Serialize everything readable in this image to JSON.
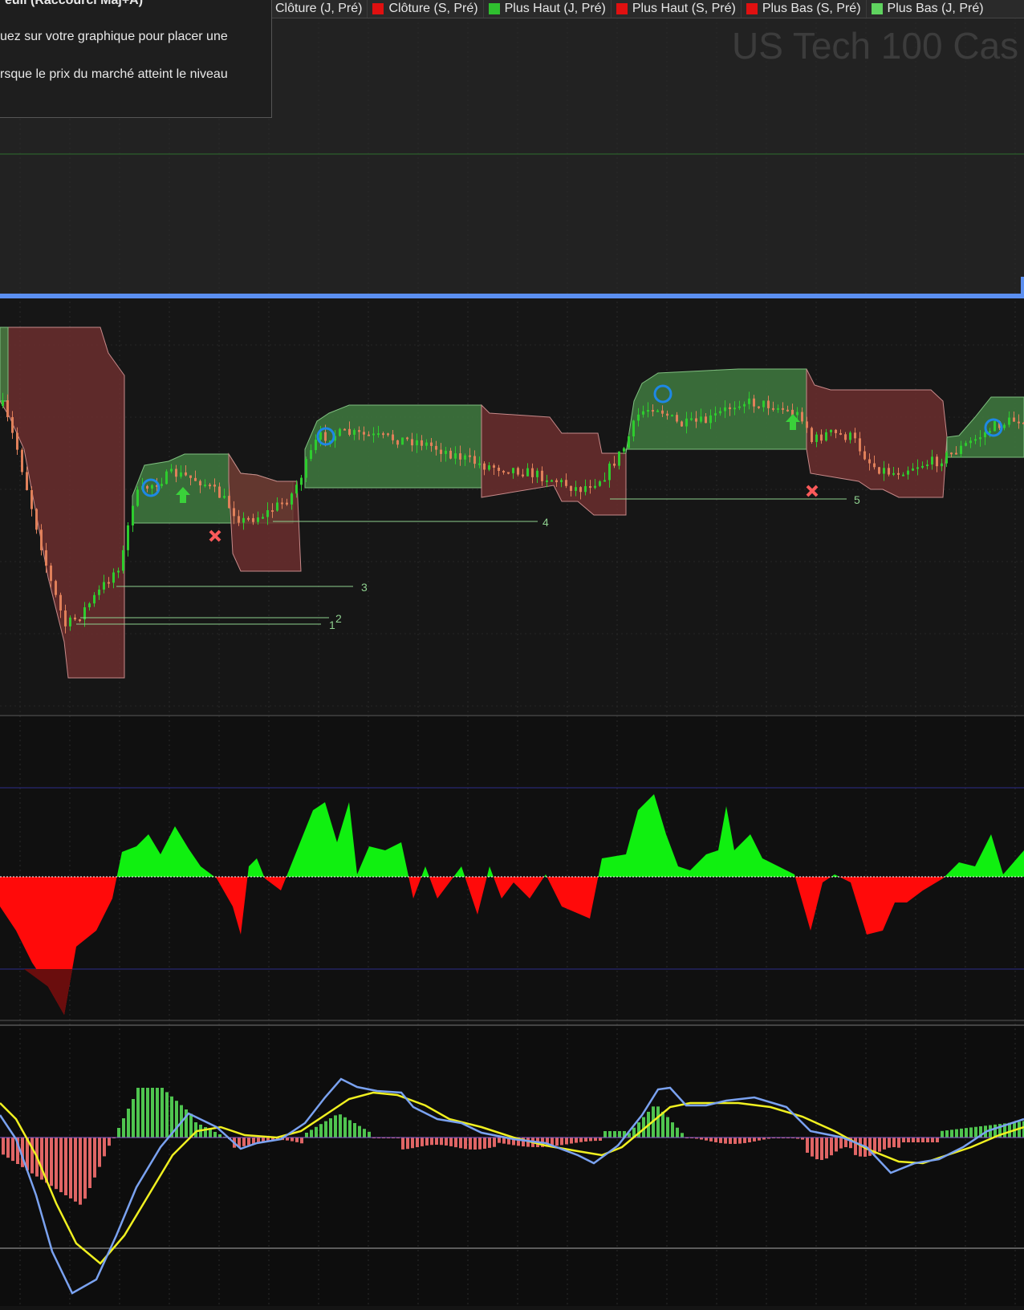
{
  "tooltip": {
    "title": "euil (Raccourci Maj+A)",
    "line1": "uez sur votre graphique pour placer une",
    "line2": "rsque le prix du marché atteint le niveau"
  },
  "legend": [
    {
      "label": "Clôture (J, Pré)",
      "color": "#2fbf2f"
    },
    {
      "label": "Clôture (S, Pré)",
      "color": "#e01010"
    },
    {
      "label": "Plus Haut (J, Pré)",
      "color": "#2fbf2f"
    },
    {
      "label": "Plus Haut (S, Pré)",
      "color": "#e01010"
    },
    {
      "label": "Plus Bas (S, Pré)",
      "color": "#e01010"
    },
    {
      "label": "Plus Bas (J, Pré)",
      "color": "#2fbf2f"
    }
  ],
  "instrument_title": "US Tech 100 Cas",
  "level_labels": [
    "1",
    "2",
    "3",
    "4",
    "5"
  ],
  "colors": {
    "bull_zone": "#3f7a3f",
    "bear_zone": "#6b2e2e",
    "bull_candle": "#2ecc2e",
    "bear_candle": "#e0805a",
    "separator": "#5b8ff0",
    "osc_positive": "#10f010",
    "osc_negative": "#ff0a0a",
    "macd_line": "#7aa2f0",
    "signal_line": "#f0f020",
    "hist_positive": "#4fc44f",
    "hist_negative": "#e06565"
  },
  "icons": {
    "entry": "circle-marker-icon",
    "long": "arrow-up-icon",
    "exit": "x-mark-icon"
  }
}
